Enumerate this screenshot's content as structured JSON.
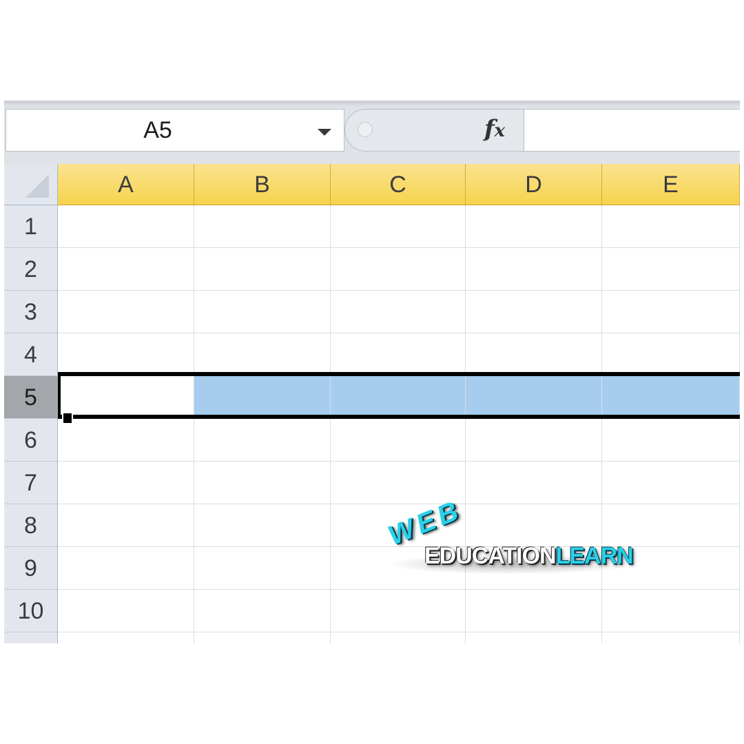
{
  "formula_bar": {
    "name_box": "A5",
    "fx_label": "fx",
    "formula": ""
  },
  "columns": [
    "A",
    "B",
    "C",
    "D",
    "E"
  ],
  "rows": [
    "1",
    "2",
    "3",
    "4",
    "5",
    "6",
    "7",
    "8",
    "9",
    "10"
  ],
  "selection": {
    "selected_row": "5",
    "active_cell": "A5"
  },
  "watermark": {
    "top": "WEB",
    "left": "EDUCATION",
    "right": "LEARN"
  },
  "colors": {
    "column_header": "#f6d34d",
    "selection_fill": "#a6cdee",
    "logo_accent": "#2ad1ea"
  }
}
